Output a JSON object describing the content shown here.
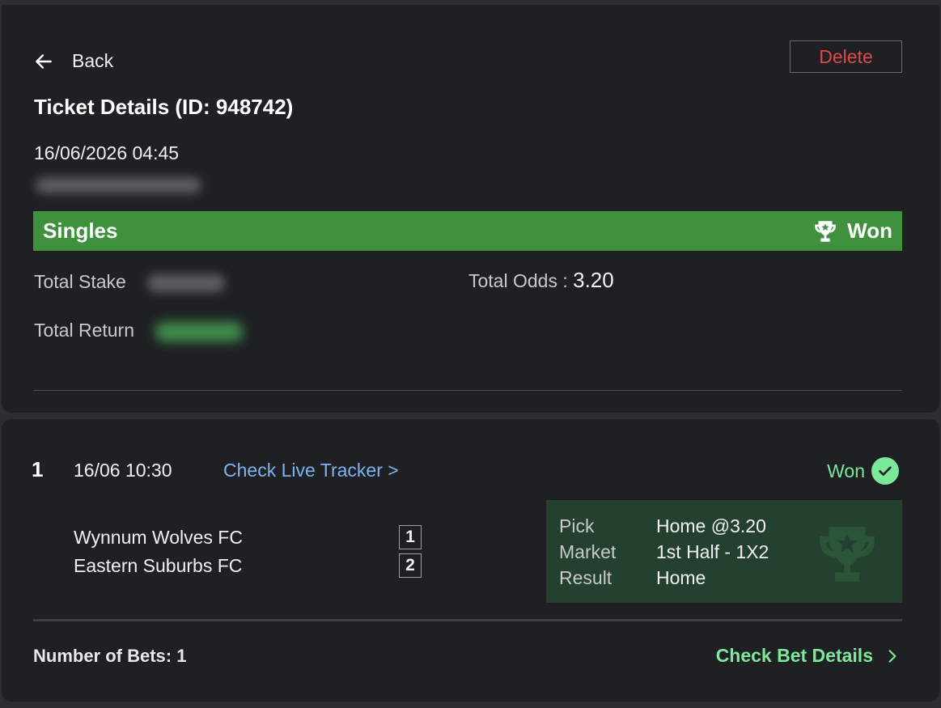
{
  "header": {
    "back_label": "Back",
    "delete_label": "Delete",
    "title": "Ticket Details (ID: 948742)",
    "datetime": "16/06/2026 04:45"
  },
  "summary": {
    "bet_type": "Singles",
    "status": "Won",
    "total_stake_label": "Total Stake",
    "total_odds_label": "Total Odds :",
    "total_odds_value": "3.20",
    "total_return_label": "Total Return"
  },
  "selection": {
    "index": "1",
    "time": "16/06 10:30",
    "tracker_link": "Check Live Tracker >",
    "status": "Won",
    "home_team": "Wynnum Wolves FC",
    "home_badge": "1",
    "away_team": "Eastern Suburbs FC",
    "away_badge": "2",
    "pick_label": "Pick",
    "pick_value": "Home @3.20",
    "market_label": "Market",
    "market_value": "1st Half - 1X2",
    "result_label": "Result",
    "result_value": "Home"
  },
  "footer": {
    "number_of_bets": "Number of Bets: 1",
    "check_details": "Check Bet Details"
  },
  "colors": {
    "banner_green": "#3f913e",
    "won_green": "#7be89a",
    "link_blue": "#7fb3f0",
    "delete_red": "#e0484c",
    "pick_box_bg": "#24412f"
  },
  "icons": {
    "back": "arrow-left-icon",
    "banner_status": "trophy-icon",
    "selection_status": "check-circle-icon",
    "details": "chevron-right-icon"
  }
}
